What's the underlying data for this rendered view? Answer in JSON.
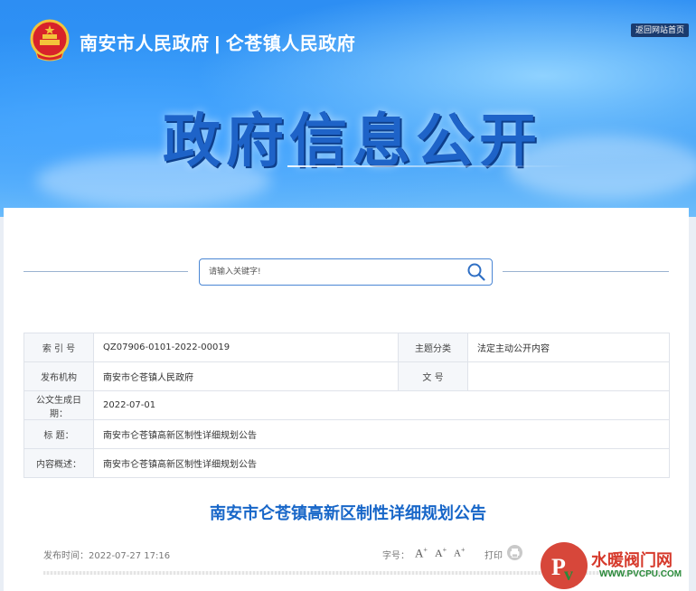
{
  "header": {
    "site_title": "南安市人民政府 | 仑苍镇人民政府",
    "home_link": "返回网站首页",
    "banner_title": "政府信息公开"
  },
  "search": {
    "placeholder": "请输入关键字!"
  },
  "meta": {
    "index_label": "索 引 号",
    "index_value": "QZ07906-0101-2022-00019",
    "category_label": "主题分类",
    "category_value": "法定主动公开内容",
    "publisher_label": "发布机构",
    "publisher_value": "南安市仑苍镇人民政府",
    "doc_no_label": "文 号",
    "doc_no_value": "",
    "date_label": "公文生成日期：",
    "date_value": "2022-07-01",
    "title_label": "标 题：",
    "title_value": "南安市仑苍镇高新区制性详细规划公告",
    "summary_label": "内容概述：",
    "summary_value": "南安市仑苍镇高新区制性详细规划公告"
  },
  "article": {
    "title": "南安市仑苍镇高新区制性详细规划公告",
    "publish_time": "发布时间：2022-07-27 17:16",
    "font_size_label": "字号：",
    "font_btn": "A",
    "font_btn_plus": "+",
    "print_label": "打印"
  },
  "watermark": {
    "text": "水暖阀门网",
    "url": "WWW.PVCPU.COM"
  },
  "colors": {
    "accent": "#1766c8",
    "banner": "#2f95f6"
  }
}
